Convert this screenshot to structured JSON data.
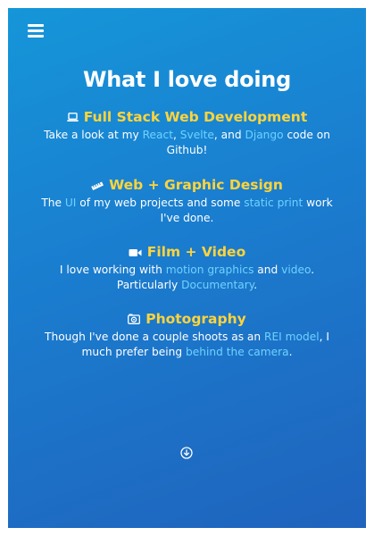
{
  "header": {
    "menu_icon": "hamburger-menu-icon",
    "title": "What I love doing"
  },
  "sections": [
    {
      "icon": "laptop-icon",
      "heading": "Full Stack Web Development",
      "text_parts": [
        "Take a look at my ",
        ", ",
        ", and ",
        " code on Github!"
      ],
      "links": [
        "React",
        "Svelte",
        "Django"
      ]
    },
    {
      "icon": "ruler-icon",
      "heading": "Web + Graphic Design",
      "text_parts": [
        "The ",
        " of my web projects and some ",
        " work I've done."
      ],
      "links": [
        "UI",
        "static print"
      ]
    },
    {
      "icon": "video-camera-icon",
      "heading": "Film + Video",
      "text_parts": [
        "I love working with ",
        " and ",
        ". Particularly ",
        "."
      ],
      "links": [
        "motion graphics",
        "video",
        "Documentary"
      ]
    },
    {
      "icon": "camera-icon",
      "heading": "Photography",
      "text_parts": [
        "Though I've done a couple shoots as an ",
        ", I much prefer being ",
        "."
      ],
      "links": [
        "REI model",
        "behind the camera"
      ]
    }
  ],
  "footer": {
    "scroll_icon": "arrow-down-circle-icon"
  },
  "colors": {
    "background_top": "#1596d9",
    "background_bottom": "#1f63bd",
    "heading": "#ffd43b",
    "link": "#6fd2ff",
    "text": "#ffffff"
  }
}
